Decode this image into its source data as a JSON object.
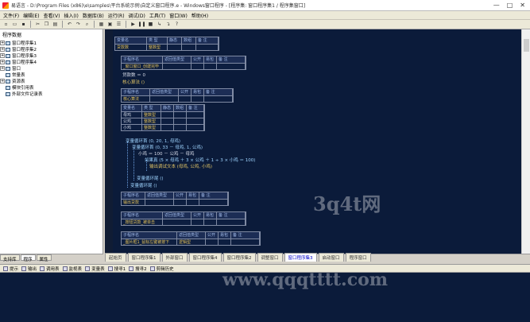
{
  "window": {
    "title": "易语言 - D:\\Program Files (x86)\\e\\samples\\平台系统示例\\自定义窗口程序.e - Windows窗口程序 - [程序集: 窗口程序集1 / 程序集窗口]",
    "minimize": "—",
    "maximize": "□",
    "close": "✕"
  },
  "menu": [
    "文件(F)",
    "编辑(E)",
    "查看(V)",
    "插入(I)",
    "数据库(B)",
    "运行(R)",
    "调试(D)",
    "工具(T)",
    "窗口(W)",
    "帮助(H)"
  ],
  "toolbar": {
    "icons": [
      "new-icon",
      "open-icon",
      "save-icon",
      "cut-icon",
      "copy-icon",
      "paste-icon",
      "undo-icon",
      "redo-icon",
      "find-icon",
      "run-icon",
      "stop-icon",
      "step-icon",
      "help-icon"
    ]
  },
  "tree": {
    "title": "程序数据",
    "items": [
      "窗口程序集1",
      "窗口程序集2",
      "窗口程序集3",
      "窗口程序集4",
      "窗口",
      "常量表",
      "资源表",
      "模块引用表",
      "外部文件记录表"
    ]
  },
  "left_tabs": [
    "支持库",
    "程序",
    "属性"
  ],
  "code": {
    "table1": {
      "headers": [
        "变量名",
        "类 型",
        "静态",
        "数组",
        "备 注"
      ],
      "values": [
        "贷款数",
        "整数型",
        "",
        "",
        ""
      ]
    },
    "table2": {
      "headers": [
        "子程序名",
        "返回值类型",
        "公开",
        "易包",
        "备 注"
      ],
      "values": [
        "_窗口窗口_创建完毕",
        "",
        "",
        "",
        ""
      ]
    },
    "line1": "贷款数 ＝ 0",
    "line2": "核心算法 ()",
    "table3": {
      "headers": [
        "子程序名",
        "返回值类型",
        "公开",
        "易包",
        "备 注"
      ],
      "values": [
        "核心算法",
        "",
        "",
        "",
        ""
      ]
    },
    "table4": {
      "headers": [
        "变量名",
        "类 型",
        "静态",
        "数组",
        "备 注"
      ],
      "rows": [
        [
          "母鸡",
          "整数型"
        ],
        [
          "公鸡",
          "整数型"
        ],
        [
          "小鸡",
          "整数型"
        ]
      ]
    },
    "loop1": "变量循环首 (0, 20, 1, 母鸡)",
    "loop2": "变量循环首 (0, 33 － 母鸡, 1, 公鸡)",
    "assign": "小鸡 ＝ 100 － 公鸡 － 母鸡",
    "ifline": "如果真 (5 × 母鸡 ＋ 3 × 公鸡 ＋ 1 ÷ 3 × 小鸡 ＝ 100)",
    "output": "输出调试文本 (母鸡, 公鸡, 小鸡)",
    "loopend1": "变量循环尾 ()",
    "loopend2": "变量循环尾 ()",
    "table5": {
      "headers": [
        "子程序名",
        "返回值类型",
        "公开",
        "易包",
        "备 注"
      ],
      "values": [
        "输出贷款",
        "",
        "",
        "",
        ""
      ]
    },
    "table6": {
      "headers": [
        "子程序名",
        "返回值类型",
        "公开",
        "易包",
        "备 注"
      ],
      "values": [
        "_按钮贷款_被单击",
        "",
        "",
        "",
        ""
      ]
    },
    "table7": {
      "headers": [
        "子程序名",
        "返回值类型",
        "公开",
        "易包",
        "备 注"
      ],
      "values": [
        "_图片框1_鼠标左键被按下",
        "逻辑型",
        "",
        "",
        ""
      ]
    }
  },
  "editor_tabs": [
    "起始页",
    "窗口程序集1",
    "外部窗口",
    "窗口程序集4",
    "窗口程序集2",
    "调整窗口",
    "窗口程序集3",
    "启动窗口",
    "程序窗口"
  ],
  "active_editor_tab": 6,
  "bottom_tabs": [
    "提示",
    "输出",
    "调用表",
    "监视表",
    "变量表",
    "搜寻1",
    "搜寻2",
    "剪辑历史"
  ],
  "watermarks": {
    "text1": "3q4t网",
    "text2": "www.qqqtttt.com"
  }
}
